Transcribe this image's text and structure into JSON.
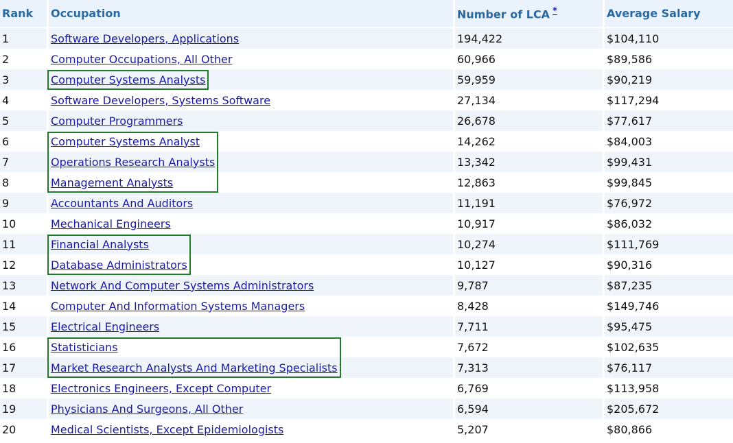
{
  "table": {
    "headers": {
      "rank": "Rank",
      "occupation": "Occupation",
      "number_of_lca": "Number of LCA",
      "footnote_marker": "*",
      "average_salary": "Average Salary"
    },
    "rows": [
      {
        "rank": "1",
        "occupation": "Software Developers, Applications",
        "lca": "194,422",
        "salary": "$104,110"
      },
      {
        "rank": "2",
        "occupation": "Computer Occupations, All Other",
        "lca": "60,966",
        "salary": "$89,586"
      },
      {
        "rank": "3",
        "occupation": "Computer Systems Analysts",
        "lca": "59,959",
        "salary": "$90,219"
      },
      {
        "rank": "4",
        "occupation": "Software Developers, Systems Software",
        "lca": "27,134",
        "salary": "$117,294"
      },
      {
        "rank": "5",
        "occupation": "Computer Programmers",
        "lca": "26,678",
        "salary": "$77,617"
      },
      {
        "rank": "6",
        "occupation": "Computer Systems Analyst",
        "lca": "14,262",
        "salary": "$84,003"
      },
      {
        "rank": "7",
        "occupation": "Operations Research Analysts",
        "lca": "13,342",
        "salary": "$99,431"
      },
      {
        "rank": "8",
        "occupation": "Management Analysts",
        "lca": "12,863",
        "salary": "$99,845"
      },
      {
        "rank": "9",
        "occupation": "Accountants And Auditors",
        "lca": "11,191",
        "salary": "$76,972"
      },
      {
        "rank": "10",
        "occupation": "Mechanical Engineers",
        "lca": "10,917",
        "salary": "$86,032"
      },
      {
        "rank": "11",
        "occupation": "Financial Analysts",
        "lca": "10,274",
        "salary": "$111,769"
      },
      {
        "rank": "12",
        "occupation": "Database Administrators",
        "lca": "10,127",
        "salary": "$90,316"
      },
      {
        "rank": "13",
        "occupation": "Network And Computer Systems Administrators",
        "lca": "9,787",
        "salary": "$87,235"
      },
      {
        "rank": "14",
        "occupation": "Computer And Information Systems Managers",
        "lca": "8,428",
        "salary": "$149,746"
      },
      {
        "rank": "15",
        "occupation": "Electrical Engineers",
        "lca": "7,711",
        "salary": "$95,475"
      },
      {
        "rank": "16",
        "occupation": "Statisticians",
        "lca": "7,672",
        "salary": "$102,635"
      },
      {
        "rank": "17",
        "occupation": "Market Research Analysts And Marketing Specialists",
        "lca": "7,313",
        "salary": "$76,117"
      },
      {
        "rank": "18",
        "occupation": "Electronics Engineers, Except Computer",
        "lca": "6,769",
        "salary": "$113,958"
      },
      {
        "rank": "19",
        "occupation": "Physicians And Surgeons, All Other",
        "lca": "6,594",
        "salary": "$205,672"
      },
      {
        "rank": "20",
        "occupation": "Medical Scientists, Except Epidemiologists",
        "lca": "5,207",
        "salary": "$80,866"
      }
    ]
  },
  "highlight_groups": [
    {
      "first_rank": 3,
      "last_rank": 3
    },
    {
      "first_rank": 6,
      "last_rank": 8
    },
    {
      "first_rank": 11,
      "last_rank": 12
    },
    {
      "first_rank": 16,
      "last_rank": 17
    }
  ],
  "colors": {
    "header_text": "#2b6aa0",
    "header_bg": "#eaf2fb",
    "row_alt_bg": "#f0f5fb",
    "link": "#1a1aa6",
    "highlight_border": "#1f7a2a"
  }
}
